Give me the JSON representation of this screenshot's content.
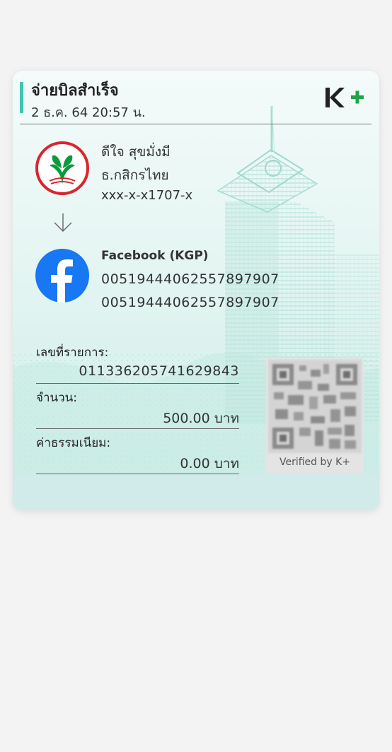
{
  "header": {
    "title": "จ่ายบิลสำเร็จ",
    "datetime": "2 ธ.ค. 64  20:57 น.",
    "brand_logo": "K+"
  },
  "sender": {
    "name": "ดีใจ สุขมั่งมี",
    "bank": "ธ.กสิกรไทย",
    "account": "xxx-x-x1707-x",
    "logo_icon": "kbank-logo-icon"
  },
  "recipient": {
    "name": "Facebook (KGP)",
    "ref1": "00519444062557897907",
    "ref2": "00519444062557897907",
    "logo_icon": "facebook-logo-icon"
  },
  "details": {
    "transaction_label": "เลขที่รายการ:",
    "transaction_value": "011336205741629843",
    "amount_label": "จำนวน:",
    "amount_value": "500.00 บาท",
    "fee_label": "ค่าธรรมเนียม:",
    "fee_value": "0.00 บาท"
  },
  "qr": {
    "caption": "Verified by K+"
  },
  "colors": {
    "accent": "#3cc6b1",
    "kbank_green": "#0a9a3c",
    "kbank_red": "#d7262e",
    "facebook_blue": "#1877f2",
    "kplus_green": "#1fa34a"
  }
}
